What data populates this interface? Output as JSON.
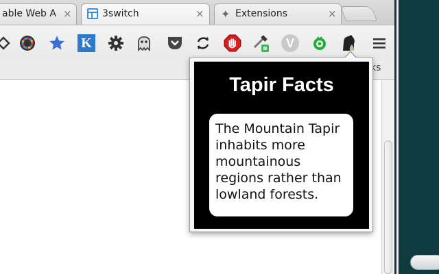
{
  "tabs": [
    {
      "title": "able Web A",
      "close": "×",
      "favicon": "none"
    },
    {
      "title": "3switch",
      "close": "×",
      "favicon": "window-icon"
    },
    {
      "title": "Extensions",
      "close": "×",
      "favicon": "puzzle-icon"
    }
  ],
  "toolbar": {
    "icons": [
      "tag-icon",
      "color-wheel-icon",
      "star-icon",
      "k-icon",
      "gear-icon",
      "ghost-icon",
      "pocket-icon",
      "sync-icon",
      "stop-hand-icon",
      "dropper-icon",
      "v-icon",
      "pacman-icon",
      "tapir-icon",
      "menu-icon"
    ],
    "k_label": "K",
    "v_label": "V"
  },
  "bookmarks": {
    "partial_text": "ks"
  },
  "popup": {
    "title": "Tapir Facts",
    "fact": "The Mountain Tapir inhabits more mountainous regions rather than lowland forests."
  },
  "colors": {
    "popup_background": "#000000",
    "card_background": "#ffffff",
    "desktop": "#0f3a40"
  }
}
